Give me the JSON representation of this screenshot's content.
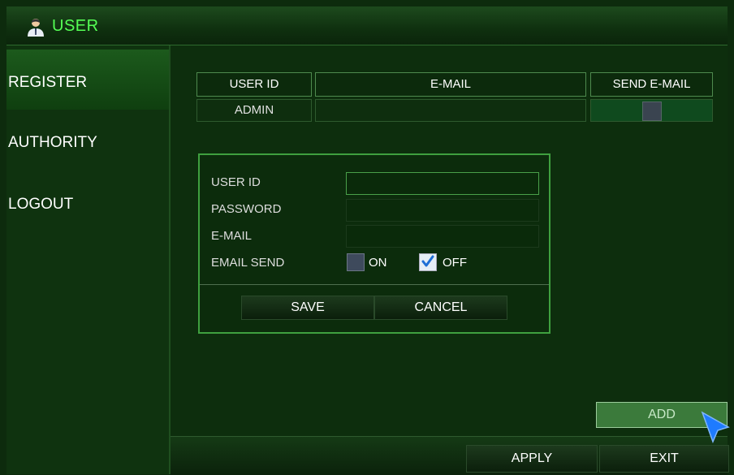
{
  "window": {
    "title": "USER",
    "icon": "user-icon"
  },
  "sidebar": {
    "items": [
      {
        "label": "REGISTER",
        "active": true
      },
      {
        "label": "AUTHORITY",
        "active": false
      },
      {
        "label": "LOGOUT",
        "active": false
      }
    ]
  },
  "table": {
    "headers": [
      "USER ID",
      "E-MAIL",
      "SEND E-MAIL"
    ],
    "rows": [
      {
        "user_id": "ADMIN",
        "email": "",
        "send_email": false
      }
    ]
  },
  "dialog": {
    "labels": {
      "user_id": "USER ID",
      "password": "PASSWORD",
      "email": "E-MAIL",
      "email_send": "EMAIL SEND"
    },
    "values": {
      "user_id": "",
      "password": "",
      "email": ""
    },
    "email_send_on_label": "ON",
    "email_send_off_label": "OFF",
    "email_send_selected": "OFF",
    "save_label": "SAVE",
    "cancel_label": "CANCEL"
  },
  "actions": {
    "add_label": "ADD",
    "apply_label": "APPLY",
    "exit_label": "EXIT"
  },
  "colors": {
    "accent": "#55ff55",
    "dialog_border": "#3fa03f",
    "cursor": "#1e7bff"
  }
}
